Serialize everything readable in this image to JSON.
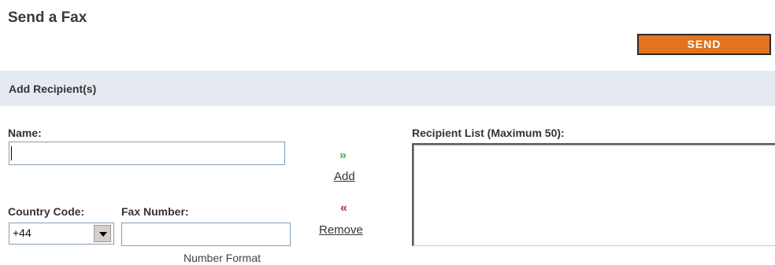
{
  "page": {
    "title": "Send a Fax"
  },
  "toolbar": {
    "send_label": "SEND"
  },
  "section": {
    "title": "Add Recipient(s)"
  },
  "form": {
    "name_label": "Name:",
    "name_value": "",
    "country_code_label": "Country Code:",
    "country_code_value": "+44",
    "fax_number_label": "Fax Number:",
    "fax_number_value": "",
    "number_format_link": "Number Format"
  },
  "actions": {
    "add_icon": "double-chevron-right",
    "add_label": "Add",
    "remove_icon": "double-chevron-left",
    "remove_label": "Remove"
  },
  "recipient_list": {
    "label": "Recipient List (Maximum 50):",
    "items": []
  },
  "colors": {
    "send_button": "#e2731f",
    "section_bar": "#e5eaf2",
    "add_arrow": "#5aa55a",
    "remove_arrow": "#a83a3a"
  }
}
